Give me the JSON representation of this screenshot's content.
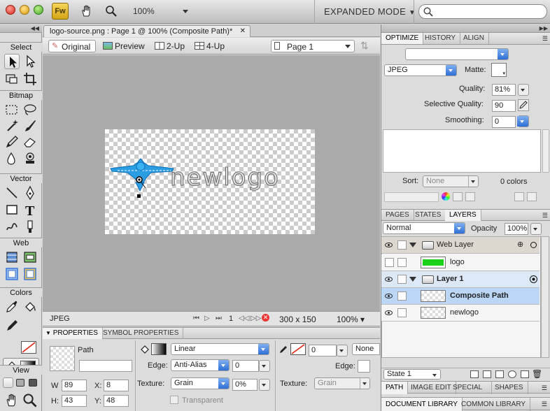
{
  "toolbar": {
    "app_logo": "Fw",
    "zoom": "100%",
    "workspace_mode": "EXPANDED MODE",
    "search_placeholder": ""
  },
  "document": {
    "tab_title": "logo-source.png : Page 1 @ 100% (Composite Path)*",
    "view_tabs": [
      "Original",
      "Preview",
      "2-Up",
      "4-Up"
    ],
    "page_select": "Page 1",
    "logo_text": "newlogo",
    "canvas_size": "300 x 150",
    "format": "JPEG",
    "frame_number": "1",
    "zoom": "100%"
  },
  "tools": {
    "sections": [
      "Select",
      "Bitmap",
      "Vector",
      "Web",
      "Colors",
      "View"
    ]
  },
  "properties": {
    "tabs": [
      "PROPERTIES",
      "SYMBOL PROPERTIES"
    ],
    "object_type": "Path",
    "object_name": "",
    "w": "89",
    "x": "8",
    "h": "43",
    "y": "48",
    "fill_type": "Linear",
    "edge_label": "Edge:",
    "edge_value": "Anti-Alias",
    "edge_amount": "0",
    "texture_label": "Texture:",
    "texture_value": "Grain",
    "texture_amount": "0%",
    "transparent_label": "Transparent",
    "stroke_size": "0",
    "stroke_type": "None",
    "stroke_edge_label": "Edge:",
    "stroke_texture_label": "Texture:",
    "stroke_texture_value": "Grain",
    "w_label": "W",
    "x_label": "X:",
    "h_label": "H:",
    "y_label": "Y:"
  },
  "optimize": {
    "tabs": [
      "OPTIMIZE",
      "HISTORY",
      "ALIGN"
    ],
    "format": "JPEG",
    "matte_label": "Matte:",
    "quality_label": "Quality:",
    "quality": "81%",
    "selective_label": "Selective Quality:",
    "selective": "90",
    "smoothing_label": "Smoothing:",
    "smoothing": "0",
    "sort_label": "Sort:",
    "sort_value": "None",
    "colors_count": "0 colors"
  },
  "layers": {
    "tabs": [
      "PAGES",
      "STATES",
      "LAYERS"
    ],
    "blend": "Normal",
    "opacity_label": "Opacity",
    "opacity": "100%",
    "rows": [
      {
        "name": "Web Layer"
      },
      {
        "name": "logo"
      },
      {
        "name": "Layer 1"
      },
      {
        "name": "Composite Path"
      },
      {
        "name": "newlogo"
      }
    ],
    "state": "State 1"
  },
  "bottom_panels": {
    "tabs1": [
      "PATH",
      "IMAGE EDIT",
      "SPECIAL CH",
      "SHAPES"
    ],
    "tabs2": [
      "DOCUMENT LIBRARY",
      "COMMON LIBRARY"
    ]
  },
  "colors": {
    "accent_blue": "#2f6fd6",
    "selection_blue": "#bcd7f6",
    "logo_blue": "#2a9ee0",
    "logo_green": "#19d219"
  }
}
